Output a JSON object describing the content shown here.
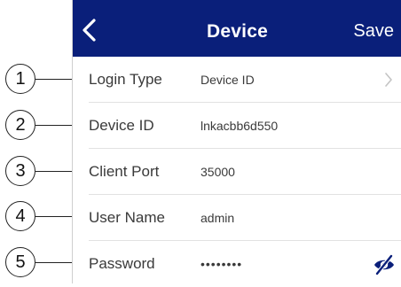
{
  "navbar": {
    "back_icon": "chevron-left-icon",
    "title": "Device",
    "save_label": "Save",
    "bg_color": "#0a1f7a"
  },
  "form": {
    "rows": [
      {
        "label": "Login Type",
        "value": "Device ID",
        "trailing_icon": "chevron-right-icon"
      },
      {
        "label": "Device ID",
        "value": "lnkacbb6d550"
      },
      {
        "label": "Client Port",
        "value": "35000"
      },
      {
        "label": "User Name",
        "value": "admin"
      },
      {
        "label": "Password",
        "value": "••••••••",
        "trailing_icon": "eye-slash-icon"
      }
    ]
  },
  "callouts": [
    "1",
    "2",
    "3",
    "4",
    "5"
  ]
}
